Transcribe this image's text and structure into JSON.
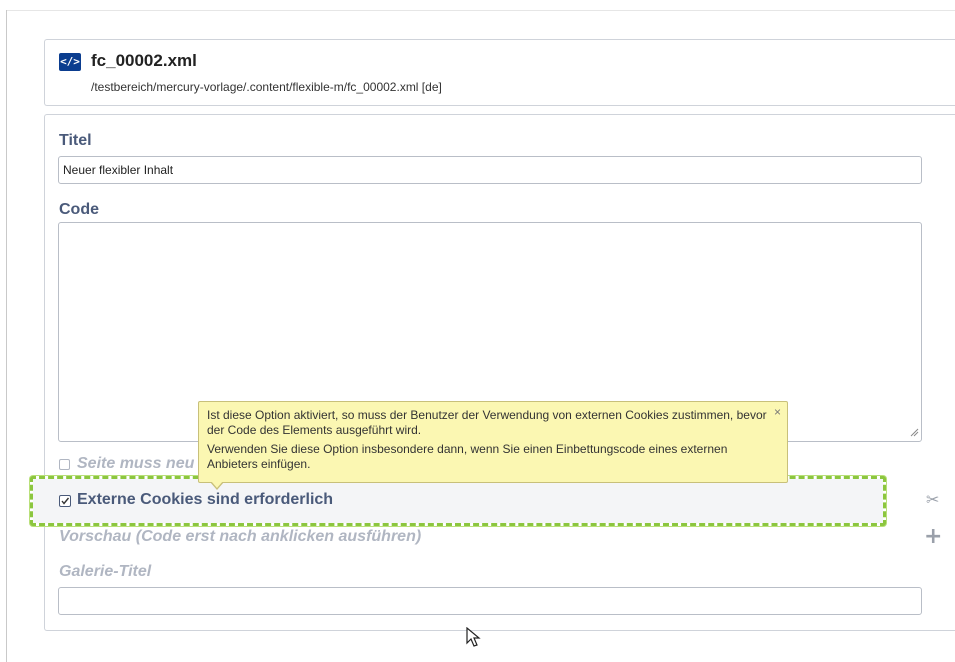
{
  "header": {
    "icon_glyph": "</>",
    "title": "fc_00002.xml",
    "path": "/testbereich/mercury-vorlage/.content/flexible-m/fc_00002.xml [de]"
  },
  "form": {
    "title_label": "Titel",
    "title_value": "Neuer flexibler Inhalt",
    "code_label": "Code",
    "code_value": "",
    "reload_label": "Seite muss neu",
    "cookies_label": "Externe Cookies sind erforderlich",
    "cookies_checked": true,
    "preview_label": "Vorschau (Code erst nach anklicken ausführen)",
    "gallery_label": "Galerie-Titel",
    "gallery_value": ""
  },
  "tooltip": {
    "line1": "Ist diese Option aktiviert, so muss der Benutzer der Verwendung von externen Cookies zustimmen, bevor der Code des Elements ausgeführt wird.",
    "line2": "Verwenden Sie diese Option insbesondere dann, wenn Sie einen Einbettungscode eines externen Anbieters einfügen.",
    "close_glyph": "×"
  },
  "side_icons": {
    "scissors_glyph": "✂",
    "plus_glyph": "+"
  },
  "colors": {
    "highlight": "#8cc63f",
    "tooltip_bg": "#fbf7b2",
    "label": "#4a5a7a",
    "icon_bg": "#0b3d8f"
  }
}
